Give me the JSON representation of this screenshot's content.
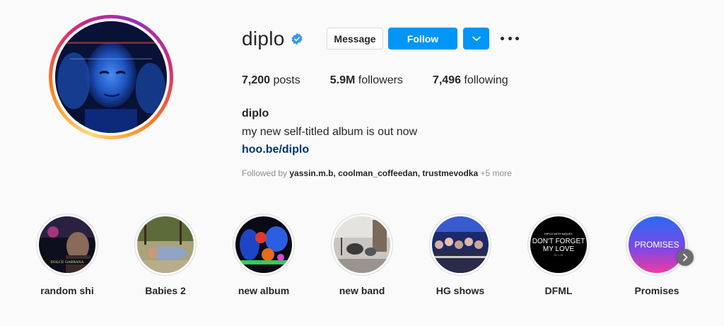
{
  "profile": {
    "username": "diplo",
    "verified": true,
    "buttons": {
      "message": "Message",
      "follow": "Follow"
    },
    "stats": {
      "posts_count": "7,200",
      "posts_label": "posts",
      "followers_count": "5.9M",
      "followers_label": "followers",
      "following_count": "7,496",
      "following_label": "following"
    },
    "bio": {
      "name": "diplo",
      "text": "my new self-titled album is out now",
      "link": "hoo.be/diplo"
    },
    "followed_by": {
      "prefix": "Followed by",
      "names": "yassin.m.b, coolman_coffeedan, trustmevodka",
      "more": "+5 more"
    }
  },
  "highlights": [
    {
      "label": "random shi",
      "overlay_text": "DOLCE GABBANA"
    },
    {
      "label": "Babies 2"
    },
    {
      "label": "new album"
    },
    {
      "label": "new band"
    },
    {
      "label": "HG shows"
    },
    {
      "label": "DFML",
      "overlay_top": "DIPLO      WITH      MIQUEL",
      "overlay_main_1": "DON'T FORGET",
      "overlay_main_2": "MY LOVE",
      "overlay_sub": "00.1.22"
    },
    {
      "label": "Promises",
      "overlay_text": "PROMISES"
    }
  ],
  "colors": {
    "accent_blue": "#0095f6",
    "link_blue": "#00376b",
    "verified_blue": "#3897f0",
    "text": "#262626",
    "muted": "#8e8e8e",
    "background": "#fafafa"
  },
  "icons": [
    "verified-badge-icon",
    "chevron-down-icon",
    "more-options-icon",
    "chevron-right-icon"
  ]
}
